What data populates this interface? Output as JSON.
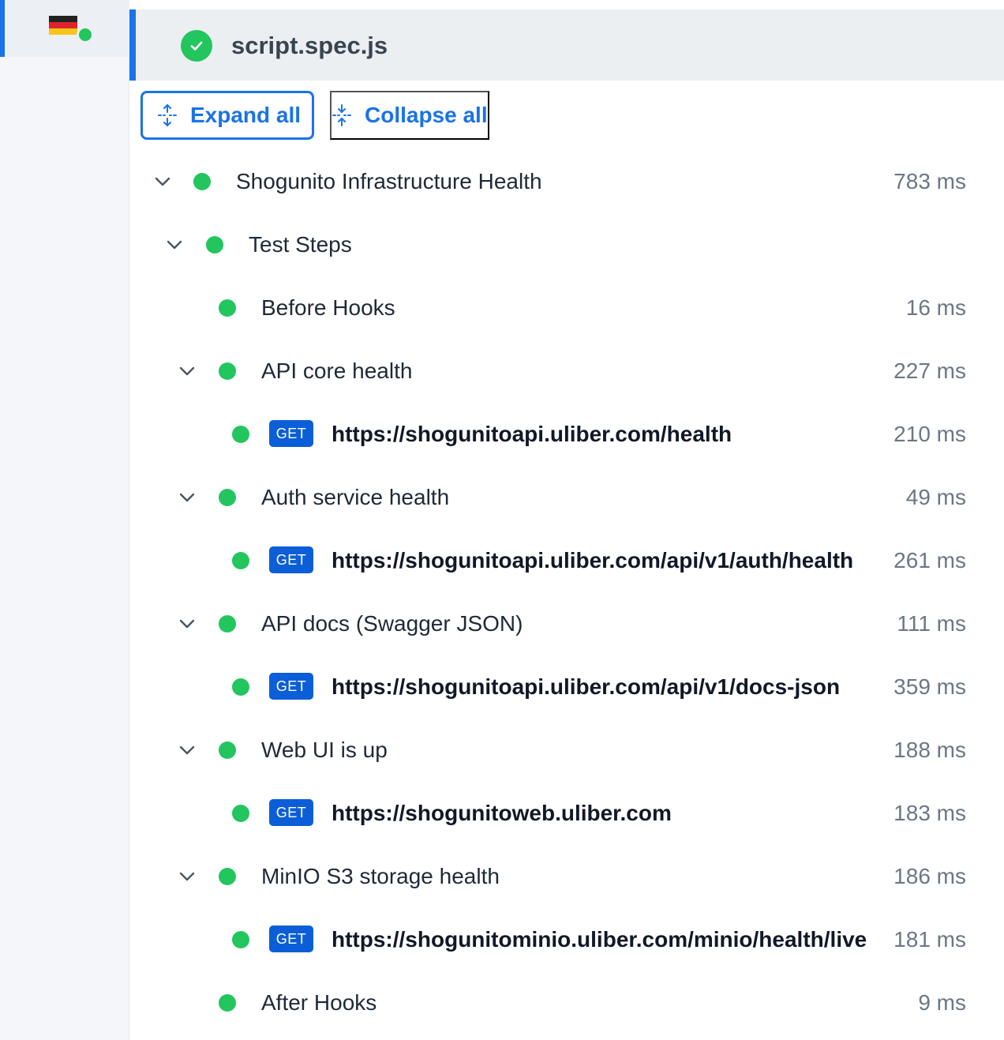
{
  "spec": {
    "title": "script.spec.js"
  },
  "toolbar": {
    "expand_label": "Expand all",
    "collapse_label": "Collapse all"
  },
  "rows": [
    {
      "label": "Shogunito Infrastructure Health",
      "duration": "783 ms"
    },
    {
      "label": "Test Steps",
      "duration": ""
    },
    {
      "label": "Before Hooks",
      "duration": "16 ms"
    },
    {
      "label": "API core health",
      "duration": "227 ms"
    },
    {
      "method": "GET",
      "label": "https://shogunitoapi.uliber.com/health",
      "duration": "210 ms"
    },
    {
      "label": "Auth service health",
      "duration": "49 ms"
    },
    {
      "method": "GET",
      "label": "https://shogunitoapi.uliber.com/api/v1/auth/health",
      "duration": "261 ms"
    },
    {
      "label": "API docs (Swagger JSON)",
      "duration": "111 ms"
    },
    {
      "method": "GET",
      "label": "https://shogunitoapi.uliber.com/api/v1/docs-json",
      "duration": "359 ms"
    },
    {
      "label": "Web UI is up",
      "duration": "188 ms"
    },
    {
      "method": "GET",
      "label": "https://shogunitoweb.uliber.com",
      "duration": "183 ms"
    },
    {
      "label": "MinIO S3 storage health",
      "duration": "186 ms"
    },
    {
      "method": "GET",
      "label": "https://shogunitominio.uliber.com/minio/health/live",
      "duration": "181 ms"
    },
    {
      "label": "After Hooks",
      "duration": "9 ms"
    }
  ],
  "colors": {
    "accent": "#1a73e8",
    "pass": "#22c55e",
    "get_badge": "#0b5ed7"
  }
}
